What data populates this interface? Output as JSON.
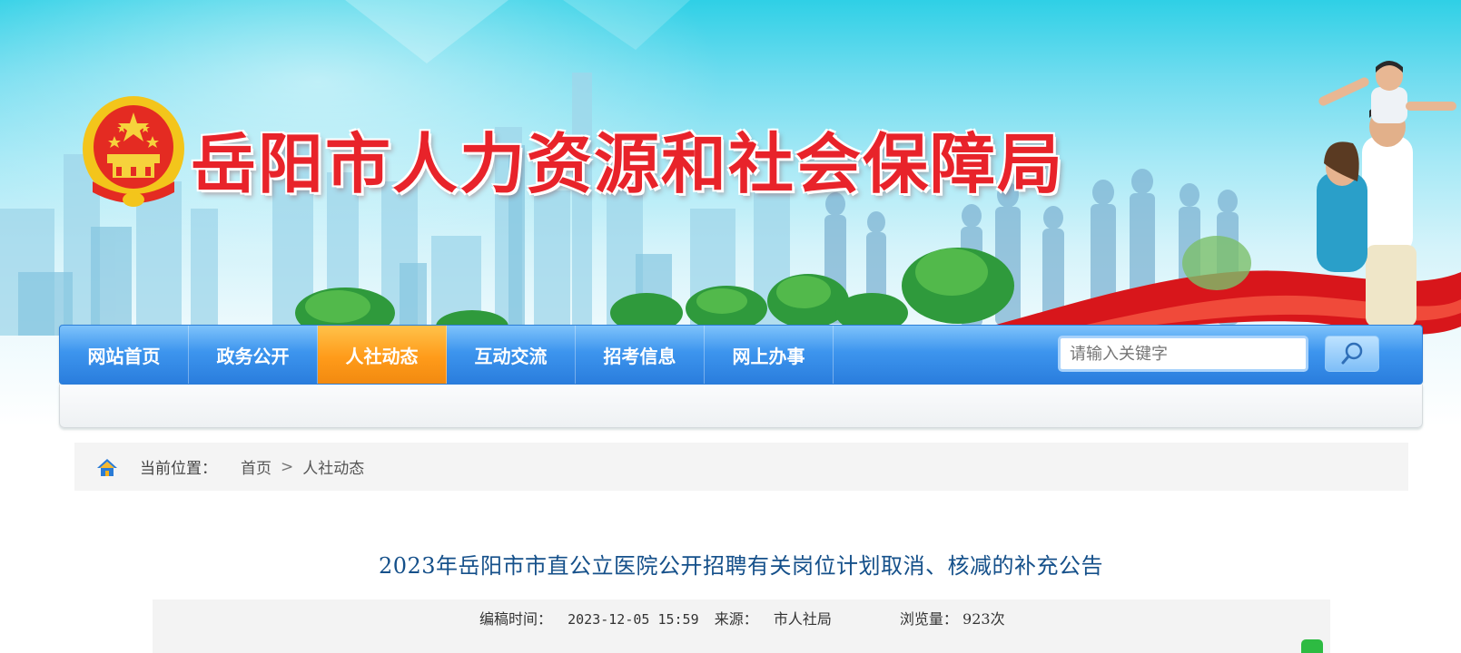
{
  "header": {
    "site_title": "岳阳市人力资源和社会保障局"
  },
  "nav": {
    "items": [
      {
        "label": "网站首页",
        "active": false
      },
      {
        "label": "政务公开",
        "active": false
      },
      {
        "label": "人社动态",
        "active": true
      },
      {
        "label": "互动交流",
        "active": false
      },
      {
        "label": "招考信息",
        "active": false
      },
      {
        "label": "网上办事",
        "active": false
      }
    ],
    "search_placeholder": "请输入关键字",
    "search_icon": "search-icon"
  },
  "breadcrumb": {
    "icon": "home-icon",
    "label": "当前位置：",
    "items": [
      "首页",
      "人社动态"
    ],
    "separator": ">"
  },
  "article": {
    "title": "2023年岳阳市市直公立医院公开招聘有关岗位计划取消、核减的补充公告",
    "edit_time_label": "编稿时间：",
    "edit_time": "2023-12-05 15:59",
    "source_label": "来源：",
    "source": "市人社局",
    "views_label": "浏览量：",
    "views": "923次",
    "share_icon": "wechat-icon"
  },
  "colors": {
    "title_red": "#e8232a",
    "nav_blue": "#3d95ee",
    "nav_active": "#ff9b1a",
    "article_title": "#15508a"
  }
}
